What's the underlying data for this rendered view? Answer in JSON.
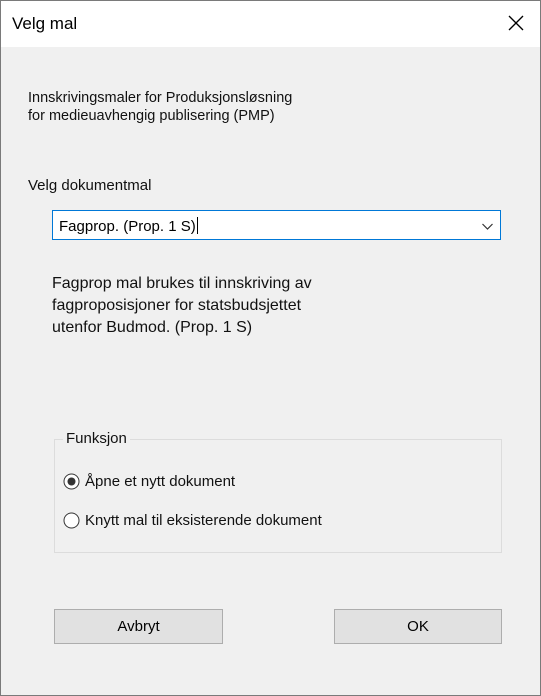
{
  "window": {
    "title": "Velg mal"
  },
  "intro": {
    "line1": "Innskrivingsmaler for Produksjonsløsning",
    "line2": "for medieuavhengig publisering (PMP)"
  },
  "template_select": {
    "label": "Velg dokumentmal",
    "value": "Fagprop. (Prop. 1 S)"
  },
  "description": {
    "line1": "Fagprop mal brukes til innskriving av",
    "line2": "fagproposisjoner for statsbudsjettet",
    "line3": "utenfor Budmod. (Prop. 1 S)"
  },
  "function_group": {
    "legend": "Funksjon",
    "options": [
      {
        "label": "Åpne et nytt dokument",
        "selected": true
      },
      {
        "label": "Knytt mal til eksisterende dokument",
        "selected": false
      }
    ]
  },
  "buttons": {
    "cancel": "Avbryt",
    "ok": "OK"
  },
  "colors": {
    "dialog_bg": "#f0f0f0",
    "focus_border": "#0078d7",
    "button_bg": "#e1e1e1"
  },
  "icons": {
    "close": "close-icon",
    "dropdown": "chevron-down-icon"
  }
}
